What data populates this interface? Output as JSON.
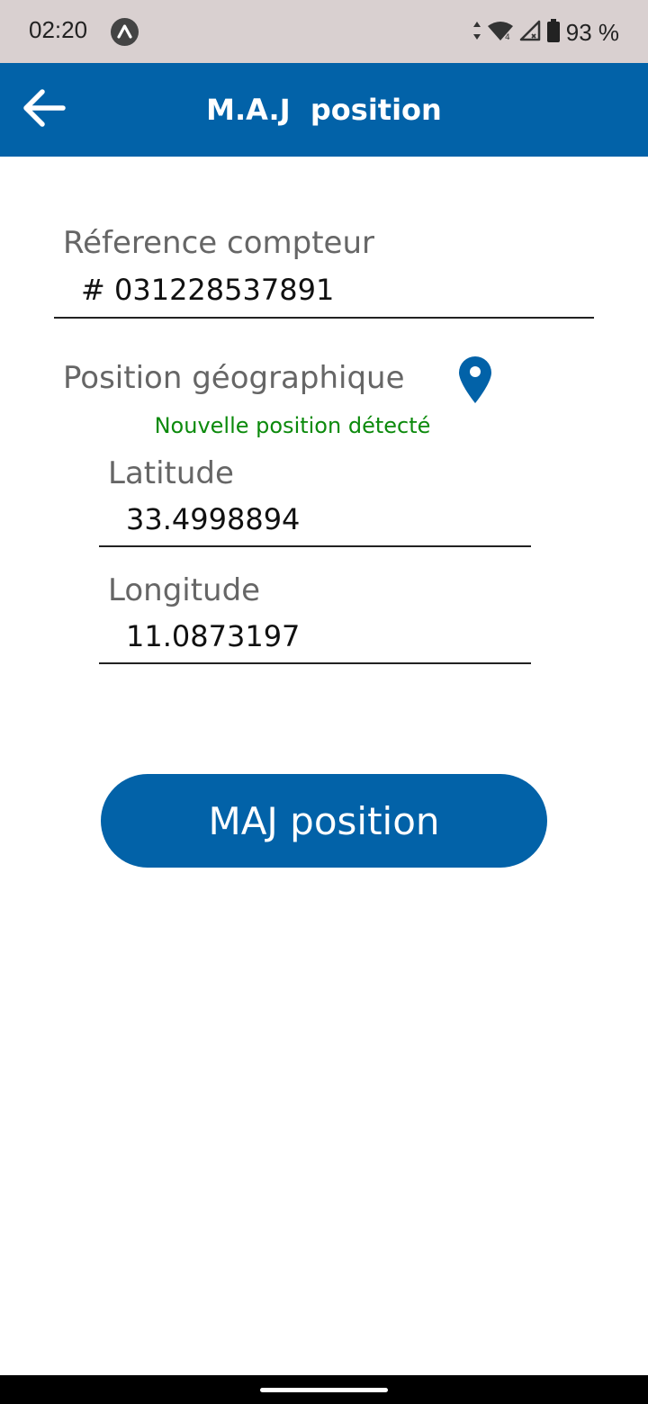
{
  "status_bar": {
    "time": "02:20",
    "battery": "93 %",
    "icons": [
      "app-indicator-icon",
      "data-arrows-icon",
      "wifi-icon",
      "signal-icon",
      "battery-icon"
    ]
  },
  "app_bar": {
    "title": "M.A.J  position",
    "back_icon": "arrow-left-icon",
    "color": "#0262a8"
  },
  "form": {
    "reference": {
      "label": "Réference compteur",
      "value": "# 031228537891"
    },
    "position": {
      "label": "Position géographique",
      "icon": "location-pin-icon",
      "status": "Nouvelle position détecté",
      "status_color": "#0c8a0c"
    },
    "latitude": {
      "label": "Latitude",
      "value": "33.4998894"
    },
    "longitude": {
      "label": "Longitude",
      "value": "11.0873197"
    }
  },
  "actions": {
    "update_label": "MAJ position",
    "color": "#0262a8"
  }
}
